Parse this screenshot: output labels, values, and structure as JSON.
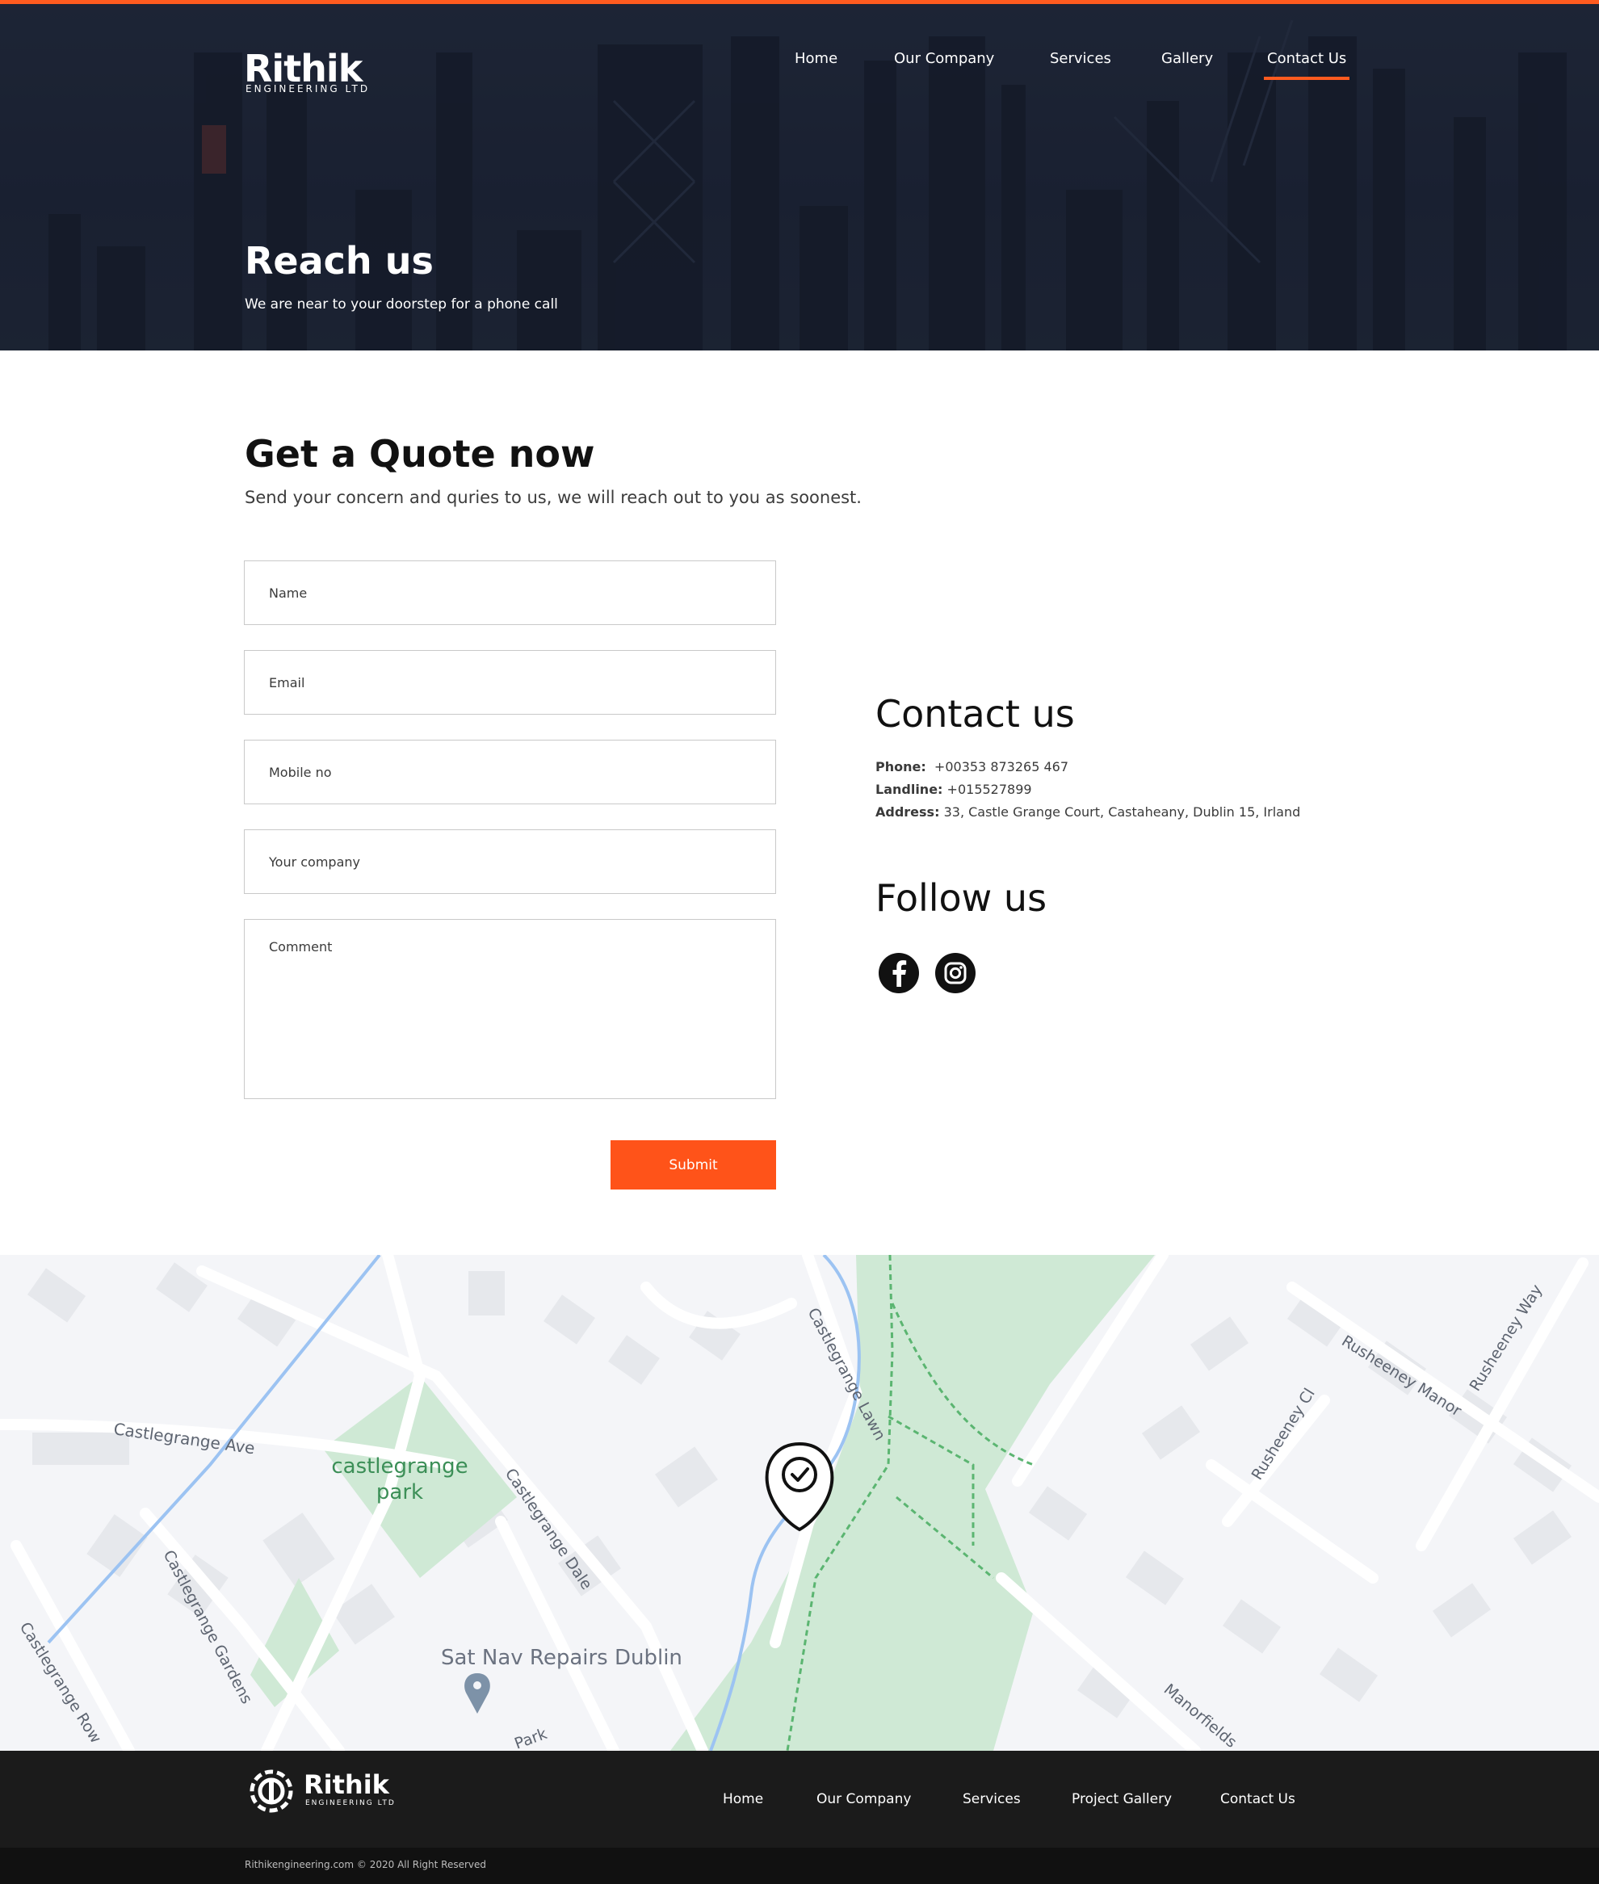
{
  "header": {
    "logo_word": "Rithik",
    "logo_sub": "ENGINEERING LTD",
    "nav": [
      {
        "label": "Home"
      },
      {
        "label": "Our Company"
      },
      {
        "label": "Services"
      },
      {
        "label": "Gallery"
      },
      {
        "label": "Contact Us",
        "active": true
      }
    ]
  },
  "hero": {
    "title": "Reach us",
    "subtitle": "We are near to your doorstep for a phone call"
  },
  "quote": {
    "title": "Get a Quote now",
    "subtitle": "Send your concern and quries to us, we will reach out to you as soonest.",
    "fields": {
      "name": "Name",
      "email": "Email",
      "mobile": "Mobile no",
      "company": "Your company",
      "comment": "Comment"
    },
    "submit_label": "Submit"
  },
  "contact": {
    "title": "Contact us",
    "phone_label": "Phone:",
    "phone_value": "+00353 873265 467",
    "landline_label": "Landline:",
    "landline_value": "+015527899",
    "address_label": "Address:",
    "address_value": "33, Castle Grange Court, Castaheany, Dublin 15, Irland"
  },
  "follow": {
    "title": "Follow us",
    "icons": [
      "facebook-icon",
      "instagram-icon"
    ]
  },
  "map": {
    "labels": {
      "castlegrange_ave": "Castlegrange Ave",
      "park_line1": "castlegrange",
      "park_line2": "park",
      "castlegrange_lawn": "Castlegrange Lawn",
      "castlegrange_dale": "Castlegrange Dale",
      "castlegrange_gardens": "Castlegrange Gardens",
      "castlegrange_row": "Castlegrange Row",
      "sat_nav": "Sat Nav Repairs Dublin",
      "park_partial": "Park",
      "rusheeney_manor": "Rusheeney Manor",
      "rusheeney_way": "Rusheeney Way",
      "rusheeney_cl": "Rusheeney Cl",
      "manorfields": "Manorfields"
    }
  },
  "footer": {
    "logo_word": "Rithik",
    "logo_sub": "ENGINEERING LTD",
    "nav": [
      "Home",
      "Our Company",
      "Services",
      "Project Gallery",
      "Contact Us"
    ],
    "copyright": "Rithikengineering.com © 2020 All Right Reserved"
  },
  "colors": {
    "accent": "#ff5319",
    "hero_bg": "#1f2637",
    "footer_bg": "#1b1b1b",
    "park_green": "#cfe9d5",
    "water_blue": "#9cc3f2"
  }
}
